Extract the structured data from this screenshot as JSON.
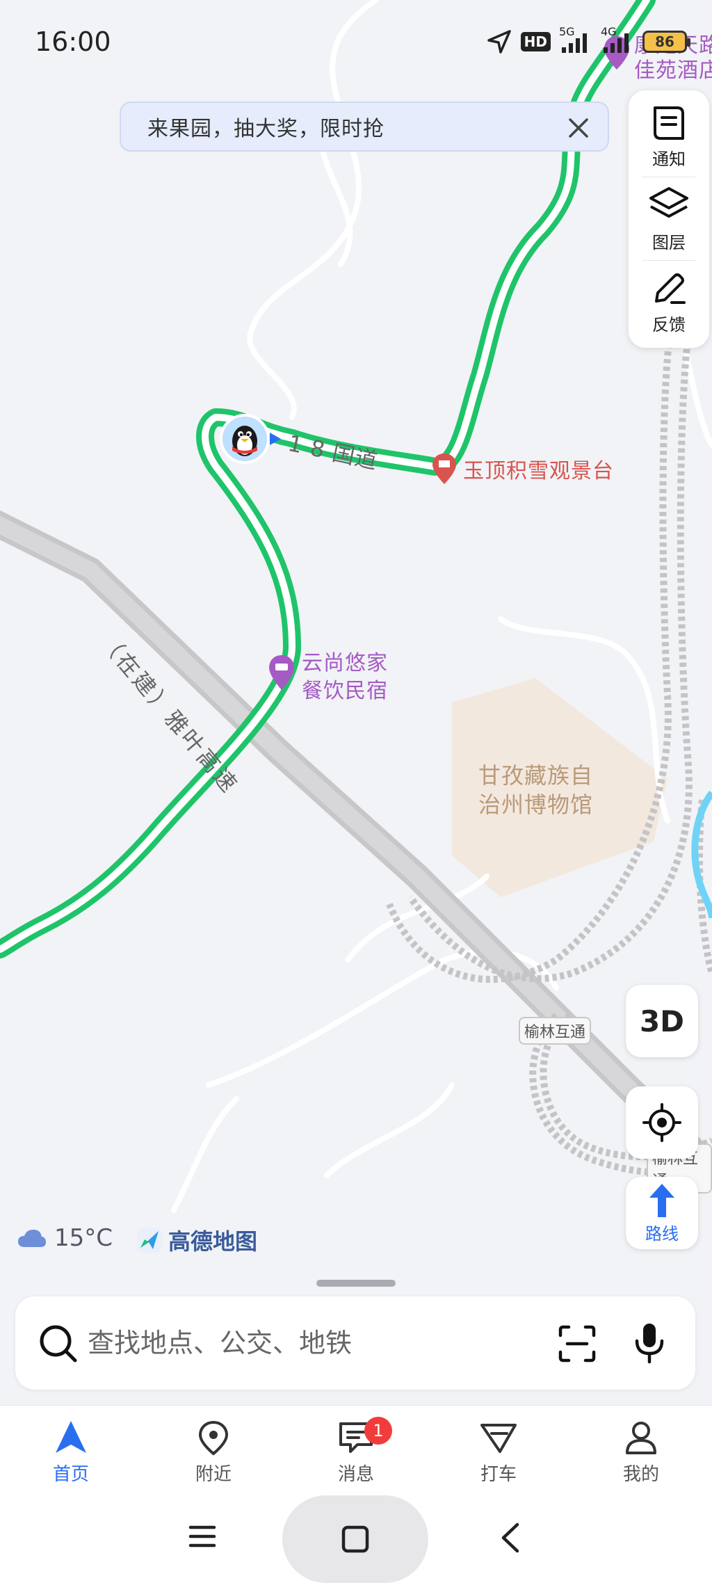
{
  "status_bar": {
    "time": "16:00",
    "network_5g": "5G",
    "network_4g": "4G",
    "hd_label": "HD",
    "battery": "86"
  },
  "promo": {
    "text": "来果园，抽大奖，限时抢"
  },
  "side_panel": {
    "notice_label": "通知",
    "layers_label": "图层",
    "feedback_label": "反馈"
  },
  "map": {
    "poi_hotel_top_line1": "康定天路",
    "poi_hotel_top_line2": "佳苑酒店",
    "road_318": "1 8 国道",
    "poi_viewpoint": "玉顶积雪观景台",
    "poi_homestay_line1": "云尚悠家",
    "poi_homestay_line2": "餐饮民宿",
    "highway_label": "（在建）雅叶高速",
    "museum_line1": "甘孜藏族自",
    "museum_line2": "治州博物馆",
    "interchange_1": "榆林互通",
    "interchange_2": "榆林互通"
  },
  "controls": {
    "btn_3d": "3D",
    "route_label": "路线"
  },
  "weather": {
    "temperature": "15°C"
  },
  "brand": {
    "name": "高德地图"
  },
  "search": {
    "placeholder": "查找地点、公交、地铁"
  },
  "tabs": [
    {
      "label": "首页",
      "active": true
    },
    {
      "label": "附近",
      "active": false
    },
    {
      "label": "消息",
      "active": false,
      "badge": "1"
    },
    {
      "label": "打车",
      "active": false
    },
    {
      "label": "我的",
      "active": false
    }
  ],
  "colors": {
    "accent": "#2a6ef0",
    "route_green": "#1fc46a",
    "badge_red": "#f23c3c",
    "poi_purple": "#a55ac4",
    "poi_red": "#d9534f"
  }
}
